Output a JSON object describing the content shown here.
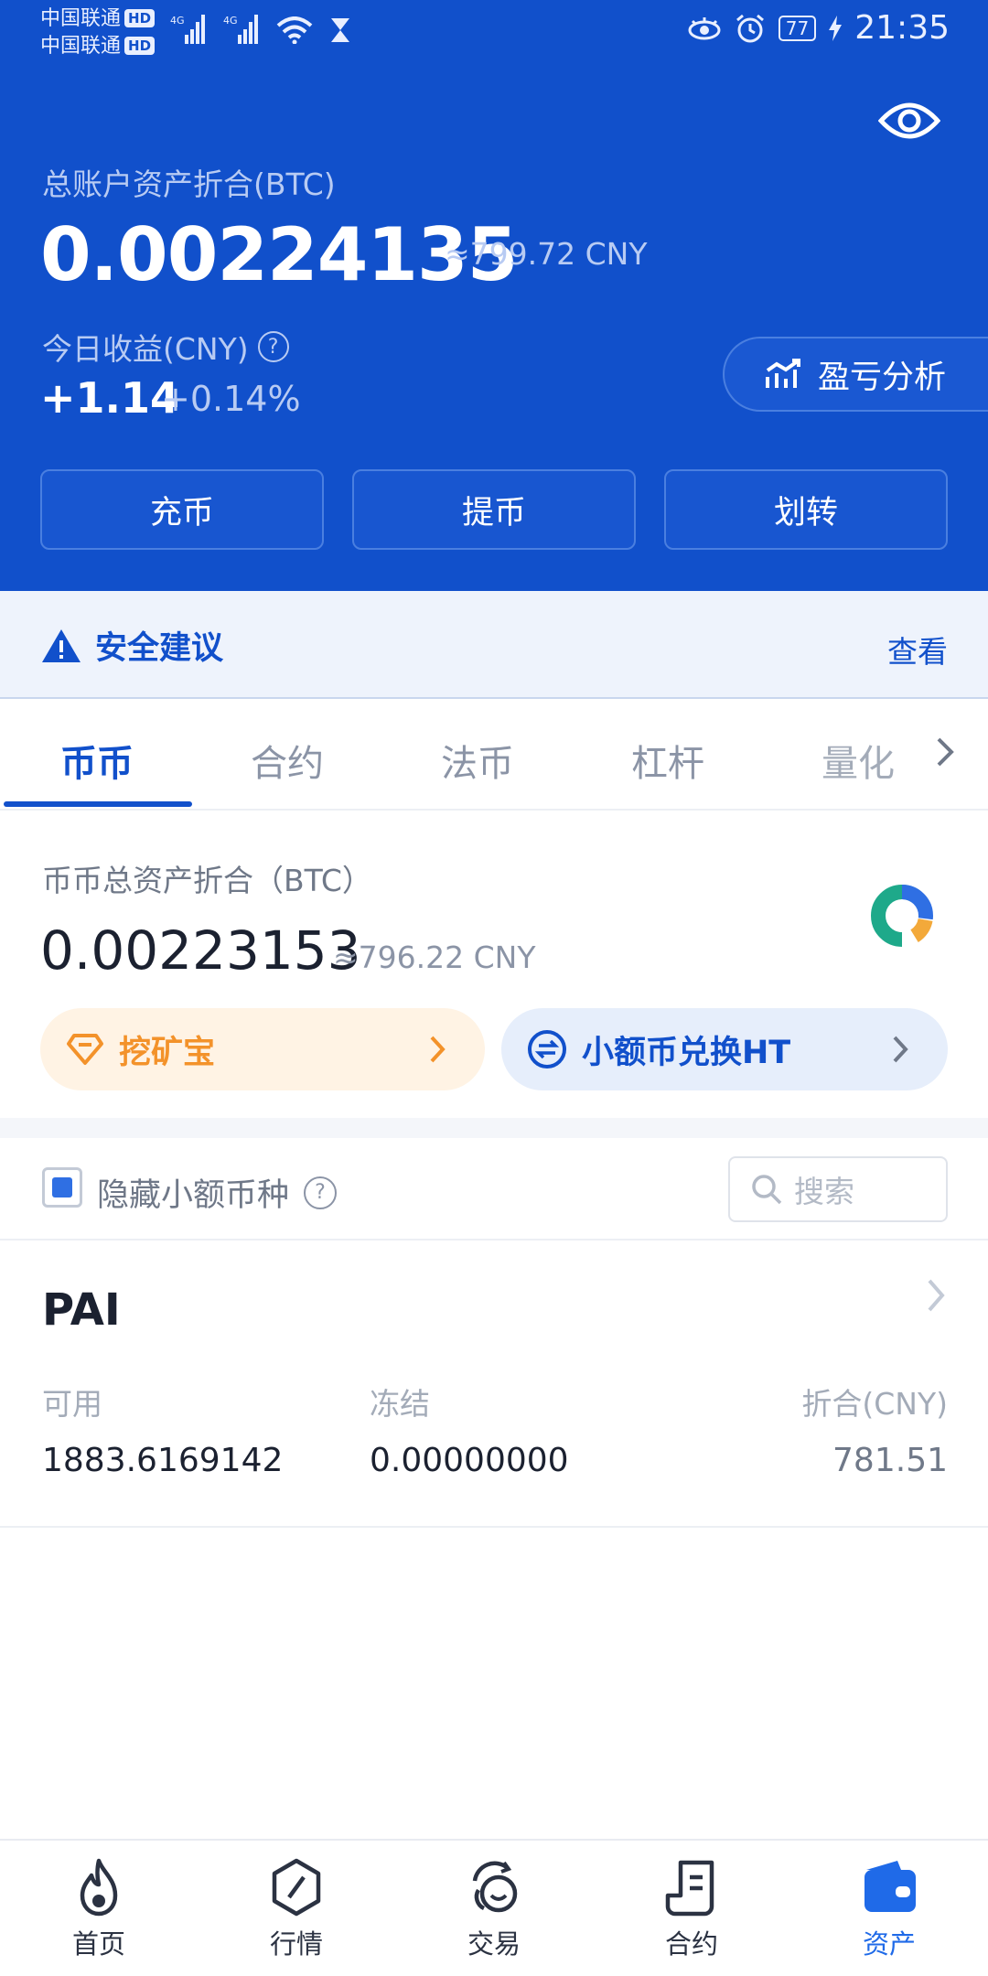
{
  "status_bar": {
    "carrier_1": "中国联通",
    "carrier_2": "中国联通",
    "hd": "HD",
    "network": "4G",
    "battery": "77",
    "time": "21:35"
  },
  "account": {
    "total_label": "总账户资产折合(BTC)",
    "total_value": "0.00224135",
    "total_cny": "≈799.72 CNY",
    "today_label": "今日收益(CNY)",
    "today_value": "+1.14",
    "today_percent": "+0.14%",
    "pnl_button": "盈亏分析"
  },
  "actions": {
    "deposit": "充币",
    "withdraw": "提币",
    "transfer": "划转"
  },
  "security": {
    "label": "安全建议",
    "view": "查看"
  },
  "tabs": [
    "币币",
    "合约",
    "法币",
    "杠杆",
    "量化"
  ],
  "coin_account": {
    "label": "币币总资产折合（BTC）",
    "value": "0.00223153",
    "cny": "≈796.22 CNY",
    "mining_label": "挖矿宝",
    "swap_label": "小额币兑换HT"
  },
  "filter": {
    "hide_small_label": "隐藏小额币种",
    "search_placeholder": "搜索"
  },
  "assets": [
    {
      "name": "PAI",
      "available_label": "可用",
      "available": "1883.6169142",
      "frozen_label": "冻结",
      "frozen": "0.00000000",
      "cny_label": "折合(CNY)",
      "cny": "781.51"
    }
  ],
  "bottom_nav": [
    "首页",
    "行情",
    "交易",
    "合约",
    "资产"
  ],
  "colors": {
    "brand_blue": "#1150cb",
    "mining_orange": "#f3922a",
    "active_nav": "#1f6ae8"
  }
}
